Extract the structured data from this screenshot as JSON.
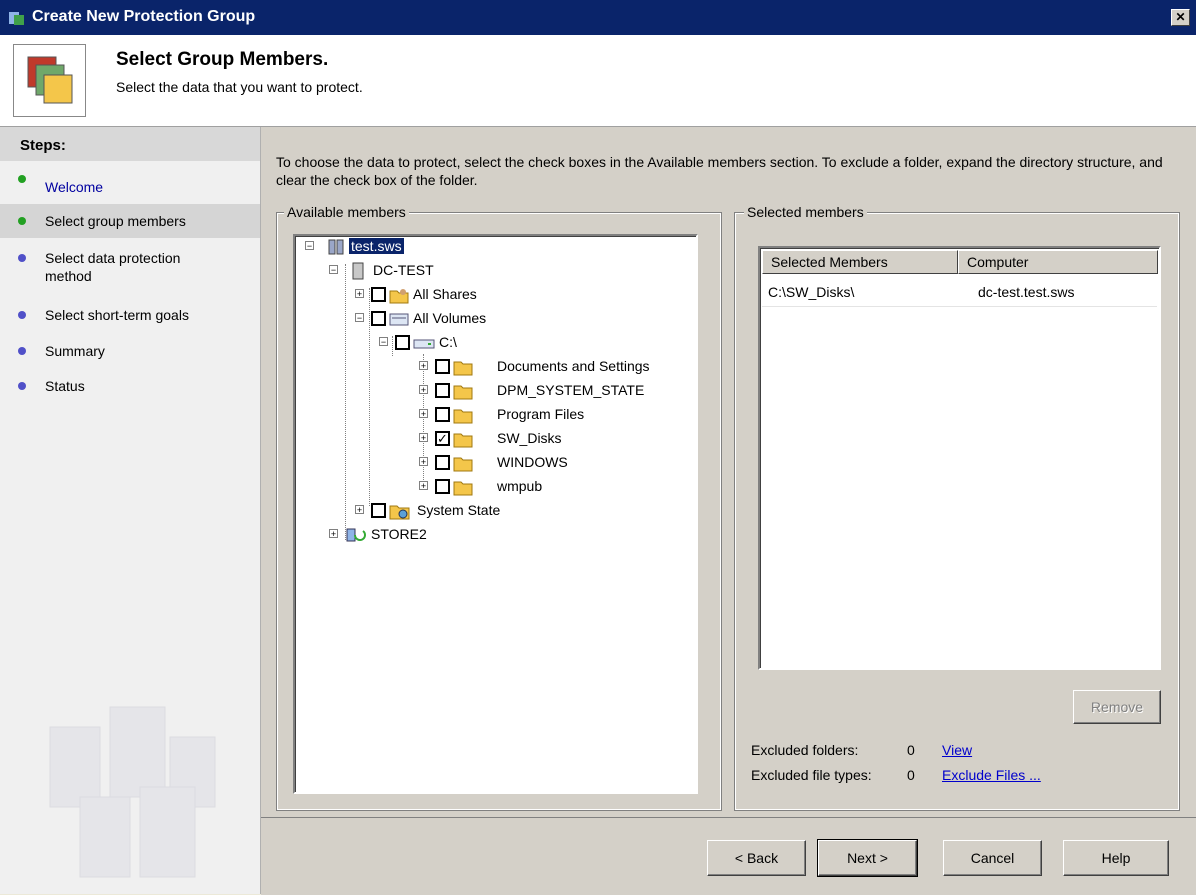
{
  "window": {
    "title": "Create New Protection Group",
    "close_label": "✕"
  },
  "header": {
    "title": "Select Group Members.",
    "subtitle": "Select the data that you want to protect."
  },
  "sidebar": {
    "heading": "Steps:",
    "items": [
      {
        "label": "Welcome",
        "color": "#22a022"
      },
      {
        "label": "Select group members",
        "color": "#22a022"
      },
      {
        "label": "Select data protection method",
        "color": "#5050c8"
      },
      {
        "label": "Select short-term goals",
        "color": "#5050c8"
      },
      {
        "label": "Summary",
        "color": "#5050c8"
      },
      {
        "label": "Status",
        "color": "#5050c8"
      }
    ]
  },
  "instructions": "To choose the data to protect, select the check boxes in the Available members section. To exclude a folder, expand the directory structure, and clear the check box of the folder.",
  "available": {
    "legend": "Available members",
    "tree": {
      "root": "test.sws",
      "server": "DC-TEST",
      "all_shares": "All Shares",
      "all_volumes": "All Volumes",
      "drive": "C:\\",
      "folders": [
        {
          "label": "Documents and Settings",
          "checked": false
        },
        {
          "label": "DPM_SYSTEM_STATE",
          "checked": false
        },
        {
          "label": "Program Files",
          "checked": false
        },
        {
          "label": "SW_Disks",
          "checked": true
        },
        {
          "label": "WINDOWS",
          "checked": false
        },
        {
          "label": "wmpub",
          "checked": false
        }
      ],
      "system_state": "System State",
      "store": "STORE2"
    }
  },
  "selected": {
    "legend": "Selected members",
    "columns": [
      "Selected Members",
      "Computer"
    ],
    "rows": [
      {
        "member": "C:\\SW_Disks\\",
        "computer": "dc-test.test.sws"
      }
    ],
    "remove_label": "Remove",
    "excluded_folders_label": "Excluded folders:",
    "excluded_folders_count": "0",
    "view_link": "View",
    "excluded_types_label": "Excluded file types:",
    "excluded_types_count": "0",
    "exclude_files_link": "Exclude Files ..."
  },
  "footer": {
    "back": "< Back",
    "next": "Next >",
    "cancel": "Cancel",
    "help": "Help"
  }
}
